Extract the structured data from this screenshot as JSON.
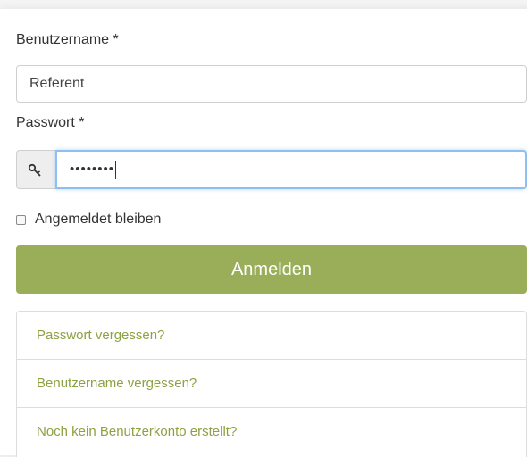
{
  "form": {
    "username_label": "Benutzername *",
    "username_value": "Referent",
    "password_label": "Passwort *",
    "password_value": "••••••••",
    "remember_label": "Angemeldet bleiben",
    "remember_checked": false,
    "login_button": "Anmelden",
    "key_icon": "key-icon"
  },
  "links": [
    {
      "label": "Passwort vergessen?"
    },
    {
      "label": "Benutzername vergessen?"
    },
    {
      "label": "Noch kein Benutzerkonto erstellt?"
    }
  ],
  "colors": {
    "accent": "#9aae5a",
    "link": "#8ca142",
    "focus_border": "#8fbff0"
  }
}
